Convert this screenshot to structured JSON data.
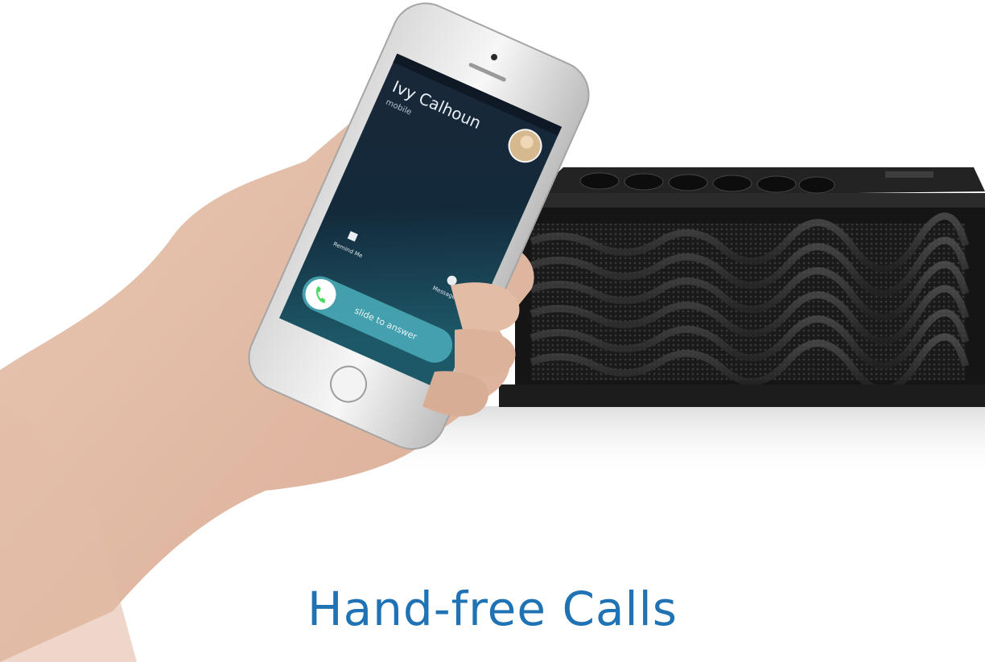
{
  "caption": "Hand-free Calls",
  "phone_screen": {
    "caller_name": "Ivy Calhoun",
    "caller_sub": "mobile",
    "remind_label": "Remind Me",
    "message_label": "Message",
    "slide_label": "slide to answer"
  },
  "colors": {
    "caption": "#1f73b5",
    "speaker_body": "#151515",
    "answer_green": "#4cd964"
  }
}
